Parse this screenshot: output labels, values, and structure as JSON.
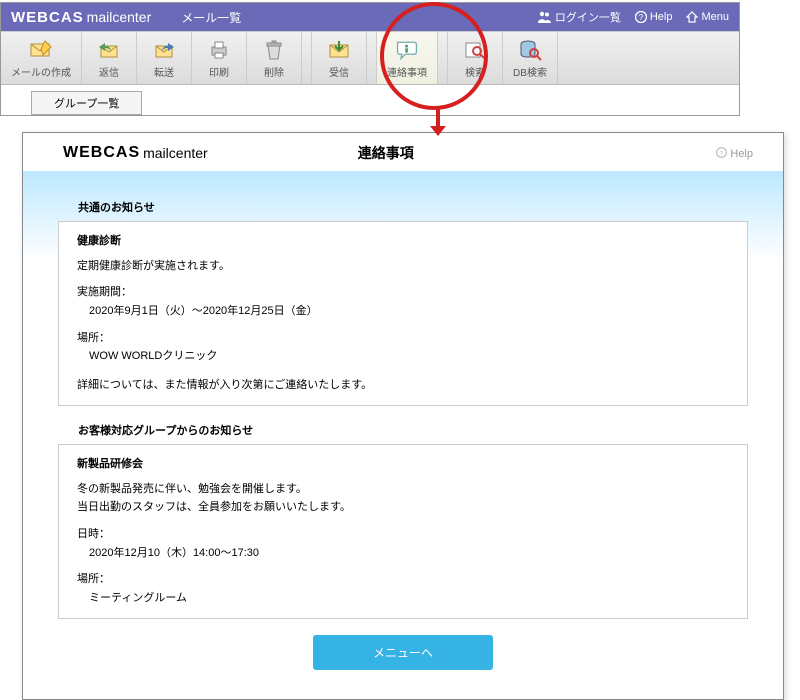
{
  "header": {
    "logo1": "WEBCAS",
    "logo2": "mailcenter",
    "mail_list": "メール一覧",
    "login_list": "ログイン一覧",
    "help": "Help",
    "menu": "Menu"
  },
  "toolbar": {
    "compose": "メールの作成",
    "reply": "返信",
    "forward": "転送",
    "print": "印刷",
    "delete": "削除",
    "receive": "受信",
    "notices": "連絡事項",
    "search": "検索",
    "dbsearch": "DB検索"
  },
  "subrow": {
    "group_list": "グループ一覧"
  },
  "popup": {
    "logo1": "WEBCAS",
    "logo2": "mailcenter",
    "title": "連絡事項",
    "help": "Help",
    "section1_label": "共通のお知らせ",
    "notice1": {
      "title": "健康診断",
      "line1": "定期健康診断が実施されます。",
      "period_label": "実施期間：",
      "period_value": "2020年9月1日（火）～2020年12月25日（金）",
      "place_label": "場所：",
      "place_value": "WOW WORLDクリニック",
      "footnote": "詳細については、また情報が入り次第にご連絡いたします。"
    },
    "section2_label": "お客様対応グループからのお知らせ",
    "notice2": {
      "title": "新製品研修会",
      "line1": "冬の新製品発売に伴い、勉強会を開催します。",
      "line2": "当日出勤のスタッフは、全員参加をお願いいたします。",
      "time_label": "日時：",
      "time_value": "2020年12月10（木）14:00～17:30",
      "place_label": "場所：",
      "place_value": "ミーティングルーム"
    },
    "menu_button": "メニューへ"
  }
}
